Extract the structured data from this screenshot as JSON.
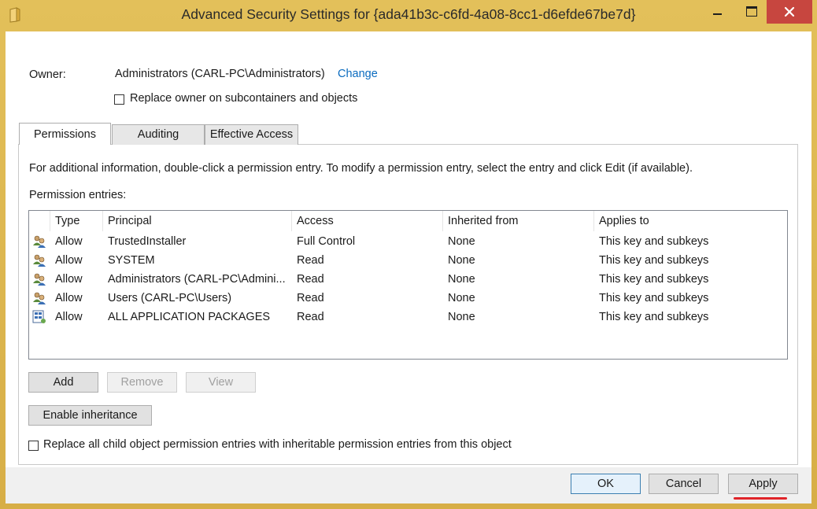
{
  "window": {
    "title": "Advanced Security Settings for {ada41b3c-c6fd-4a08-8cc1-d6efde67be7d}"
  },
  "owner": {
    "label": "Owner:",
    "value": "Administrators (CARL-PC\\Administrators)",
    "change_link": "Change",
    "replace_checkbox_label": "Replace owner on subcontainers and objects",
    "replace_checked": false
  },
  "tabs": [
    {
      "label": "Permissions",
      "active": true
    },
    {
      "label": "Auditing",
      "active": false
    },
    {
      "label": "Effective Access",
      "active": false
    }
  ],
  "panel": {
    "info_text": "For additional information, double-click a permission entry. To modify a permission entry, select the entry and click Edit (if available).",
    "entries_label": "Permission entries:",
    "columns": [
      "Type",
      "Principal",
      "Access",
      "Inherited from",
      "Applies to"
    ],
    "rows": [
      {
        "icon": "users-group-icon",
        "type": "Allow",
        "principal": "TrustedInstaller",
        "access": "Full Control",
        "inherited": "None",
        "applies": "This key and subkeys"
      },
      {
        "icon": "users-group-icon",
        "type": "Allow",
        "principal": "SYSTEM",
        "access": "Read",
        "inherited": "None",
        "applies": "This key and subkeys"
      },
      {
        "icon": "users-group-icon",
        "type": "Allow",
        "principal": "Administrators (CARL-PC\\Admini...",
        "access": "Read",
        "inherited": "None",
        "applies": "This key and subkeys"
      },
      {
        "icon": "users-group-icon",
        "type": "Allow",
        "principal": "Users (CARL-PC\\Users)",
        "access": "Read",
        "inherited": "None",
        "applies": "This key and subkeys"
      },
      {
        "icon": "app-packages-icon",
        "type": "Allow",
        "principal": "ALL APPLICATION PACKAGES",
        "access": "Read",
        "inherited": "None",
        "applies": "This key and subkeys"
      }
    ],
    "buttons": {
      "add": "Add",
      "remove": "Remove",
      "view": "View",
      "enable_inheritance": "Enable inheritance"
    },
    "replace_child_label": "Replace all child object permission entries with inheritable permission entries from this object",
    "replace_child_checked": false
  },
  "footer": {
    "ok": "OK",
    "cancel": "Cancel",
    "apply": "Apply"
  },
  "colors": {
    "frame": "#dcb64e",
    "close": "#c7463f",
    "link": "#0a6bbf",
    "annotation": "#e0242a"
  }
}
